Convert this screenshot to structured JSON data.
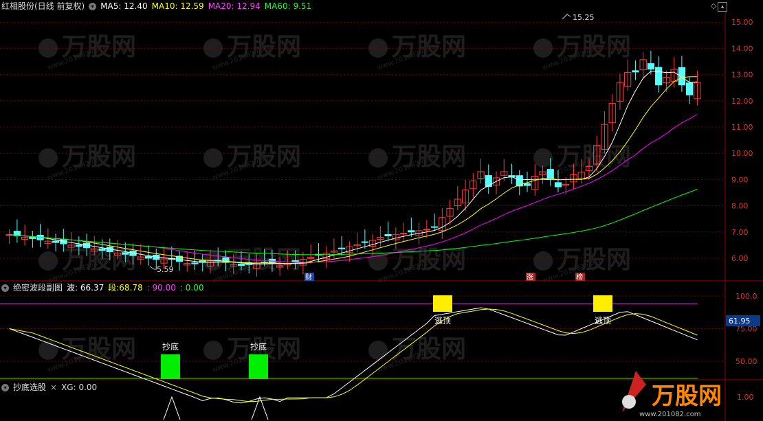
{
  "main": {
    "title": "红相股份(日线 前复权)",
    "ma": [
      {
        "label": "MA5:",
        "value": "12.40",
        "color": "#ffffff"
      },
      {
        "label": "MA10:",
        "value": "12.59",
        "color": "#ffff00"
      },
      {
        "label": "MA20:",
        "value": "12.94",
        "color": "#ff00ff"
      },
      {
        "label": "MA60:",
        "value": "9.51",
        "color": "#00ff00"
      }
    ],
    "axis_ticks": [
      "15.00",
      "14.00",
      "13.00",
      "12.00",
      "11.00",
      "10.00",
      "9.00",
      "8.00",
      "7.00",
      "6.00"
    ],
    "high_label": "15.25",
    "low_label": "5.59",
    "markers": [
      "财",
      "涨",
      "榜"
    ]
  },
  "sub1": {
    "title": "绝密波段副图",
    "items": [
      {
        "label": "波:",
        "value": "66.37",
        "color": "#ffffff"
      },
      {
        "label": "段:",
        "value": "68.78",
        "color": "#ffff00"
      },
      {
        "label": ":",
        "value": "90.00",
        "color": "#ff00ff"
      },
      {
        "label": ":",
        "value": "0.00",
        "color": "#00ff00"
      }
    ],
    "axis_ticks": [
      "100.0",
      "75.00",
      "50.00"
    ],
    "current_value": "61.95",
    "buy_label": "抄底",
    "sell_label": "逃顶"
  },
  "sub2": {
    "title": "抄底选股",
    "xg_label": "XG:",
    "xg_value": "0.00",
    "axis_tick": "1.00"
  },
  "watermark": {
    "brand": "万股网",
    "url": "www.201082.com"
  },
  "colors": {
    "up": "#ff3c3c",
    "down": "#54ffff",
    "grid": "#7a0000",
    "axis": "#e23030"
  }
}
